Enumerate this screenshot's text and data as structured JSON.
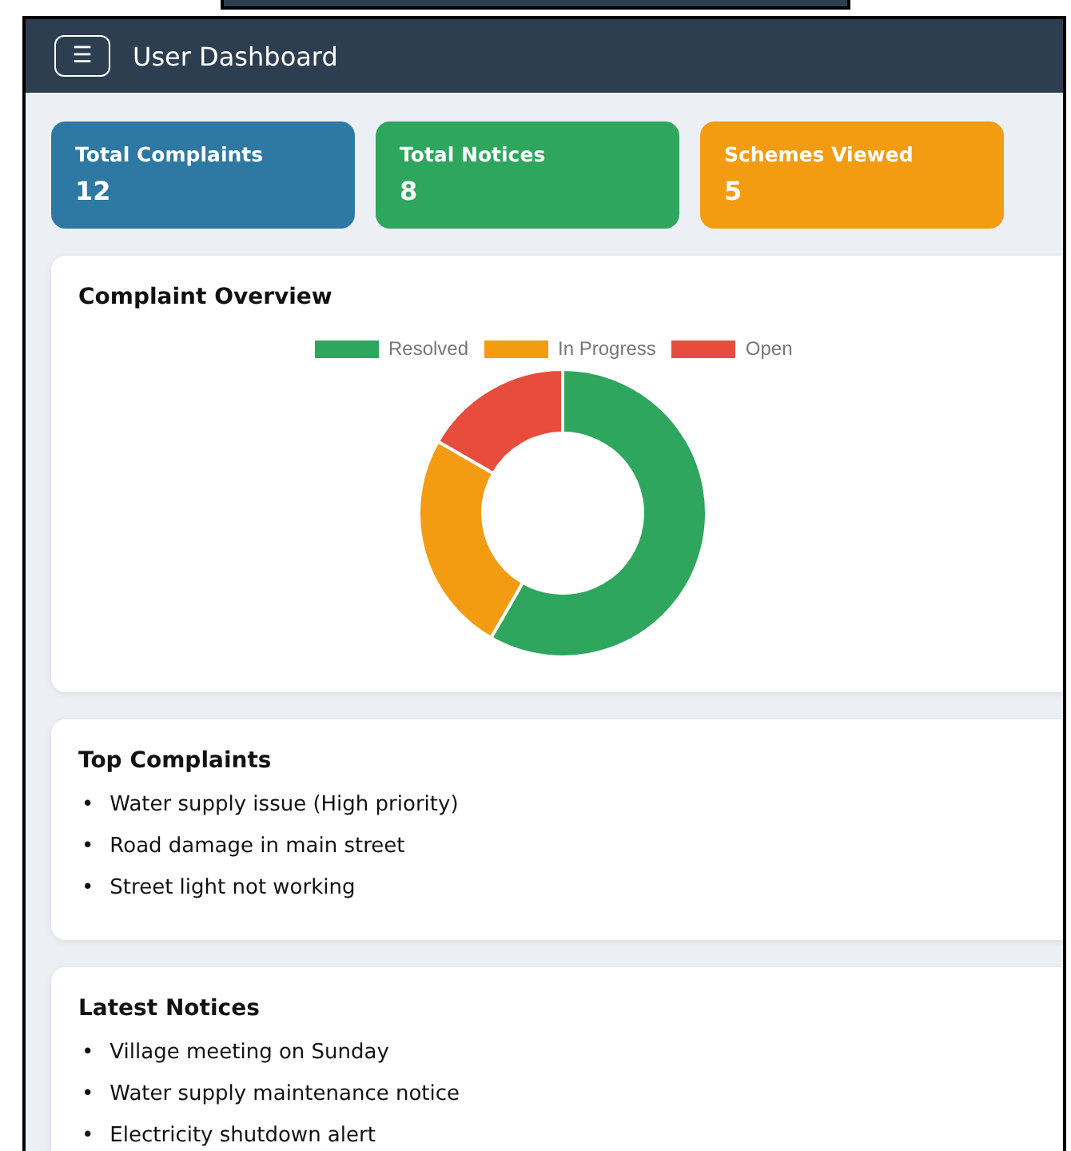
{
  "header": {
    "menu_icon": "☰",
    "title": "User Dashboard"
  },
  "stats": [
    {
      "label": "Total Complaints",
      "value": "12",
      "color": "#2e78a4"
    },
    {
      "label": "Total Notices",
      "value": "8",
      "color": "#2ea65e"
    },
    {
      "label": "Schemes Viewed",
      "value": "5",
      "color": "#f39c12"
    }
  ],
  "overview": {
    "title": "Complaint Overview",
    "chart_data": {
      "type": "donut",
      "categories": [
        "Resolved",
        "In Progress",
        "Open"
      ],
      "values": [
        58.3,
        25,
        16.7
      ],
      "colors": [
        "#2ea65e",
        "#f39c12",
        "#e74c3c"
      ]
    }
  },
  "sections": [
    {
      "title": "Top Complaints",
      "items": [
        {
          "marker": "•",
          "text": "Water supply issue (High priority)"
        },
        {
          "marker": "•",
          "text": "Road damage in main street"
        },
        {
          "marker": "•",
          "text": "Street light not working"
        }
      ]
    },
    {
      "title": "Latest Notices",
      "items": [
        {
          "marker": "•",
          "text": "Village meeting on Sunday"
        },
        {
          "marker": "•",
          "text": "Water supply maintenance notice"
        },
        {
          "marker": "•",
          "text": "Electricity shutdown alert"
        }
      ]
    }
  ]
}
